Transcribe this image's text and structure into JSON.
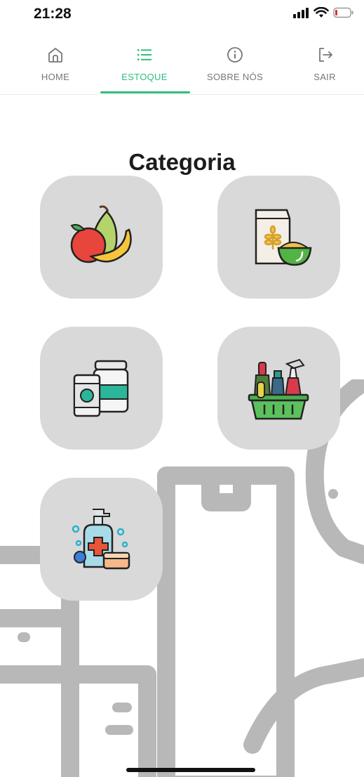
{
  "status": {
    "time": "21:28"
  },
  "nav": {
    "tabs": [
      {
        "label": "HOME",
        "icon": "home-icon"
      },
      {
        "label": "ESTOQUE",
        "icon": "list-icon",
        "active": true
      },
      {
        "label": "SOBRE NÓS",
        "icon": "info-icon"
      },
      {
        "label": "SAIR",
        "icon": "logout-icon"
      }
    ]
  },
  "page": {
    "title": "Categoria"
  },
  "categories": [
    {
      "icon": "fruits-icon"
    },
    {
      "icon": "grains-bowl-icon"
    },
    {
      "icon": "canned-goods-icon"
    },
    {
      "icon": "cleaning-basket-icon"
    },
    {
      "icon": "hygiene-soap-icon"
    }
  ],
  "colors": {
    "accent": "#2ebd7f",
    "tile": "#d9d9d9",
    "background_art": "#b8b8b8"
  }
}
